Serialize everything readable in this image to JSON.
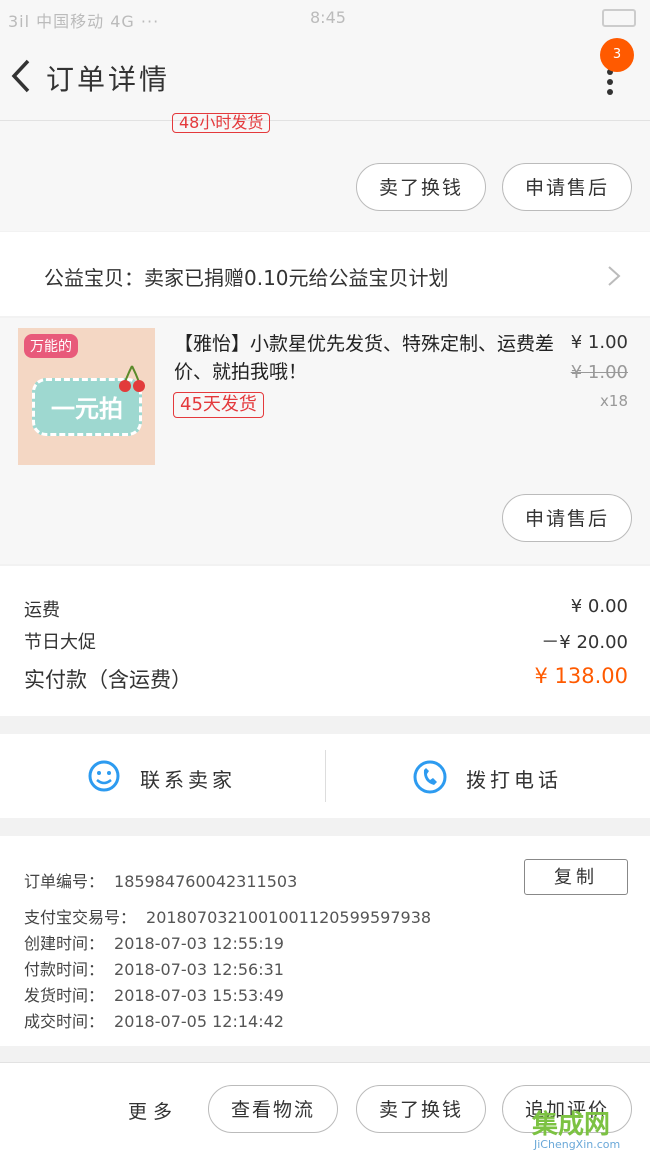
{
  "status_bar": {
    "left": "3il 中国移动 4G ···",
    "center": "8:45"
  },
  "nav": {
    "title": "订单详情",
    "badge": "3"
  },
  "top_section": {
    "partial_tag": "48小时发货",
    "btn_buy_again": "卖了换钱",
    "btn_after_sale": "申请售后"
  },
  "charity": {
    "text": "公益宝贝：卖家已捐赠0.10元给公益宝贝计划"
  },
  "product": {
    "thumb_top": "万能的",
    "thumb_main": "一元拍",
    "title": "【雅怡】小款星优先发货、特殊定制、运费差价、就拍我哦！",
    "tag": "45天发货",
    "price": "¥ 1.00",
    "orig_price": "¥ 1.00",
    "qty": "x18",
    "btn_after_sale": "申请售后"
  },
  "summary": {
    "shipping_label": "运费",
    "shipping_value": "¥ 0.00",
    "promo_label": "节日大促",
    "promo_value": "－¥ 20.00",
    "paid_label": "实付款（含运费）",
    "paid_value": "¥ 138.00"
  },
  "contact": {
    "seller": "联系卖家",
    "phone": "拨打电话"
  },
  "info": {
    "order_no_label": "订单编号：",
    "order_no": "185984760042311503",
    "copy_btn": "复制",
    "alipay_label": "支付宝交易号：",
    "alipay_no": "2018070321001001120599597938",
    "created_label": "创建时间：",
    "created": "2018-07-03 12:55:19",
    "paid_label": "付款时间：",
    "paid": "2018-07-03 12:56:31",
    "shipped_label": "发货时间：",
    "shipped": "2018-07-03 15:53:49",
    "deal_label": "成交时间：",
    "deal": "2018-07-05 12:14:42"
  },
  "bottom_bar": {
    "more": "更多",
    "logistics": "查看物流",
    "resell": "卖了换钱",
    "review": "追加评价"
  },
  "watermark": {
    "brand": "集成网",
    "url": "JiChengXin.com"
  },
  "colors": {
    "accent": "#ff5a00",
    "tag_red": "#e4393c",
    "contact_blue": "#2d9bf0"
  }
}
